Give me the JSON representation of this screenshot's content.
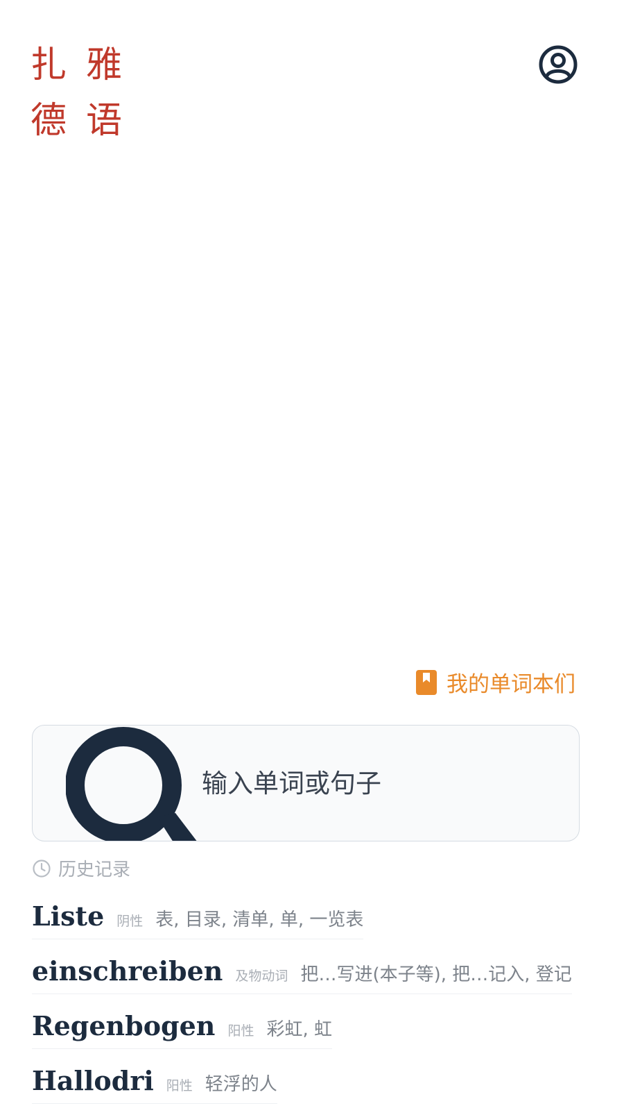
{
  "app": {
    "logo_chars": [
      "扎",
      "雅",
      "德",
      "语"
    ]
  },
  "header": {
    "profile_icon": "user-circle-icon"
  },
  "wordbooks": {
    "label": "我的单词本们",
    "icon": "bookmark-book-icon",
    "color": "#e98a2a"
  },
  "search": {
    "placeholder": "输入单词或句子",
    "icon": "search-icon"
  },
  "history": {
    "label": "历史记录",
    "icon": "clock-icon",
    "items": [
      {
        "word": "Liste",
        "pos": "阴性",
        "meaning": "表, 目录, 清单, 单, 一览表"
      },
      {
        "word": "einschreiben",
        "pos": "及物动词",
        "meaning": "把…写进(本子等), 把…记入, 登记"
      },
      {
        "word": "Regenbogen",
        "pos": "阳性",
        "meaning": "彩虹, 虹"
      },
      {
        "word": "Hallodri",
        "pos": "阳性",
        "meaning": "轻浮的人"
      }
    ]
  },
  "colors": {
    "logo": "#c0392b",
    "primary_dark": "#1c2b3e",
    "muted": "#a9aeb5"
  }
}
